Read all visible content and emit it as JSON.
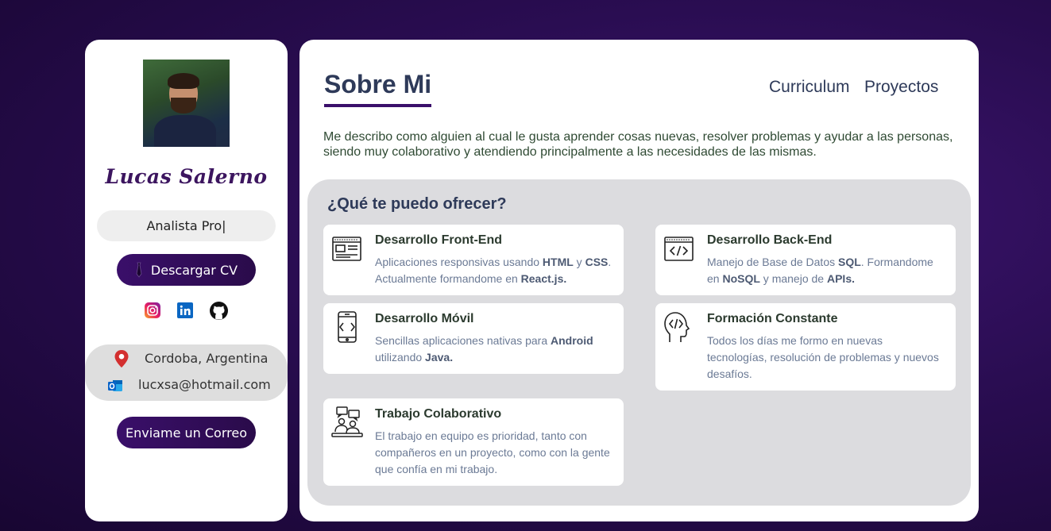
{
  "profile": {
    "name": "Lucas Salerno",
    "role": "Analista Pro|",
    "download_cv": "Descargar CV",
    "location": "Cordoba, Argentina",
    "email": "lucxsa@hotmail.com",
    "send_mail": "Enviame un Correo",
    "socials": [
      "instagram-icon",
      "linkedin-icon",
      "github-icon"
    ]
  },
  "header": {
    "title": "Sobre Mi",
    "nav": [
      "Curriculum",
      "Proyectos"
    ]
  },
  "about": "Me describo como alguien al cual le gusta aprender cosas nuevas, resolver problemas y ayudar a las personas, siendo muy colaborativo y atendiendo principalmente a las necesidades de las mismas.",
  "offer": {
    "title": "¿Qué te puedo ofrecer?",
    "cards": [
      {
        "icon": "browser-window-icon",
        "title": "Desarrollo Front-End",
        "desc": [
          {
            "t": "Aplicaciones responsivas usando "
          },
          {
            "t": "HTML",
            "b": true
          },
          {
            "t": " y "
          },
          {
            "t": "CSS",
            "b": true
          },
          {
            "t": ". Actualmente formandome en "
          },
          {
            "t": "React.js.",
            "b": true
          }
        ]
      },
      {
        "icon": "code-window-icon",
        "title": "Desarrollo Back-End",
        "desc": [
          {
            "t": "Manejo de Base de Datos "
          },
          {
            "t": "SQL",
            "b": true
          },
          {
            "t": ". Formandome en "
          },
          {
            "t": "NoSQL",
            "b": true
          },
          {
            "t": " y manejo de "
          },
          {
            "t": "APIs.",
            "b": true
          }
        ]
      },
      {
        "icon": "mobile-code-icon",
        "title": "Desarrollo Móvil",
        "desc": [
          {
            "t": "Sencillas aplicaciones nativas para "
          },
          {
            "t": "Android",
            "b": true
          },
          {
            "t": " utilizando "
          },
          {
            "t": "Java.",
            "b": true
          }
        ]
      },
      {
        "icon": "head-code-icon",
        "title": "Formación Constante",
        "desc": [
          {
            "t": "Todos los días me formo en nuevas tecnologías, resolución de problemas y nuevos desafíos."
          }
        ]
      },
      {
        "icon": "team-chat-icon",
        "title": "Trabajo Colaborativo",
        "desc": [
          {
            "t": "El trabajo en equipo es prioridad, tanto con compañeros en un proyecto, como con la gente que confía en mi trabajo."
          }
        ]
      }
    ]
  },
  "colors": {
    "accent": "#3a0f6a",
    "title": "#2e3a59",
    "background": "#2a0d52"
  }
}
